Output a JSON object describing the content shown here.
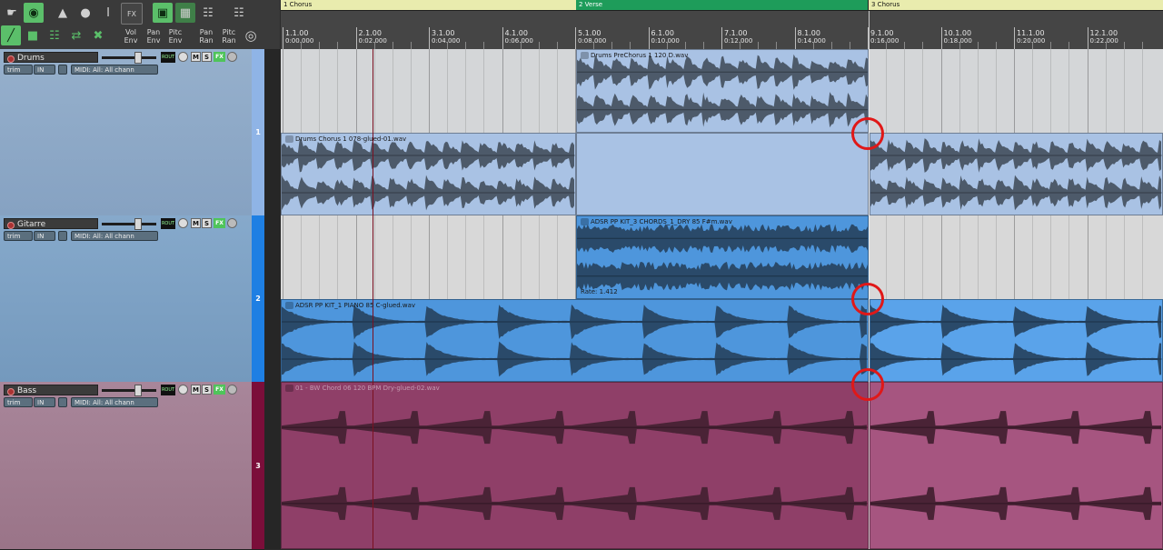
{
  "toolbar": {
    "row1_icons": [
      "cursor-tool-icon",
      "ripple-edit-icon",
      "metronome-icon",
      "record-icon",
      "text-cursor-icon",
      "fx-icon",
      "snap-icon",
      "grid-icon",
      "envelope-lock-icon",
      "midi-editor-icon"
    ],
    "fx_label": "FX",
    "env_buttons": [
      {
        "top": "Vol",
        "bottom": "Env"
      },
      {
        "top": "Pan",
        "bottom": "Env"
      },
      {
        "top": "Pitc",
        "bottom": "Env"
      },
      {
        "top": "Pan",
        "bottom": "Ran"
      },
      {
        "top": "Pitc",
        "bottom": "Ran"
      }
    ]
  },
  "tracks": [
    {
      "name": "Drums",
      "number": "1",
      "trim": "trim",
      "input": "IN",
      "midi": "MIDI: All: All chann",
      "mute": "M",
      "solo": "S",
      "fx": "FX",
      "tcp_color": "#8faacb",
      "strip_color": "#8fb4e6"
    },
    {
      "name": "Gitarre",
      "number": "2",
      "trim": "trim",
      "input": "IN",
      "midi": "MIDI: All: All chann",
      "mute": "M",
      "solo": "S",
      "fx": "FX",
      "tcp_color": "#7fa3c6",
      "strip_color": "#1e7fe3"
    },
    {
      "name": "Bass",
      "number": "3",
      "trim": "trim",
      "input": "IN",
      "midi": "MIDI: All: All chann",
      "mute": "M",
      "solo": "S",
      "fx": "FX",
      "tcp_color": "#a07c90",
      "strip_color": "#7b0e3a"
    }
  ],
  "regions": [
    {
      "label": "1  Chorus",
      "color": "#e9ecae"
    },
    {
      "label": "2  Verse",
      "color": "#1e9c5a"
    },
    {
      "label": "3  Chorus",
      "color": "#e9ecae"
    }
  ],
  "ruler": [
    {
      "bar": "1.1.00",
      "time": "0:00.000"
    },
    {
      "bar": "2.1.00",
      "time": "0:02.000"
    },
    {
      "bar": "3.1.00",
      "time": "0:04.000"
    },
    {
      "bar": "4.1.00",
      "time": "0:06.000"
    },
    {
      "bar": "5.1.00",
      "time": "0:08.000"
    },
    {
      "bar": "6.1.00",
      "time": "0:10.000"
    },
    {
      "bar": "7.1.00",
      "time": "0:12.000"
    },
    {
      "bar": "8.1.00",
      "time": "0:14.000"
    },
    {
      "bar": "9.1.00",
      "time": "0:16.000"
    },
    {
      "bar": "10.1.00",
      "time": "0:18.000"
    },
    {
      "bar": "11.1.00",
      "time": "0:20.000"
    },
    {
      "bar": "12.1.00",
      "time": "0:22.000"
    }
  ],
  "items": {
    "drums_prechorus": "Drums PreChorus 1 120 D.wav",
    "drums_chorus": "Drums Chorus 1 078-glued-01.wav",
    "guitar_chords": "ADSR PP KIT_3 CHORDS_1_DRY 85 F#m.wav",
    "guitar_rate": "Rate: 1.412",
    "guitar_piano": "ADSR PP KIT_1 PIANO 85 C-glued.wav",
    "bass": "01 - BW Chord 06 120 BPM Dry-glued-02.wav"
  },
  "item_colors": {
    "drums_light": "#a9c2e4",
    "drums_gray": "#d4d6d8",
    "guitar_blue": "#4e96dc",
    "guitar_gray": "#d8d8d8",
    "bass_pink": "#99466f"
  },
  "annotations": {
    "highlight_color": "#e01818"
  }
}
